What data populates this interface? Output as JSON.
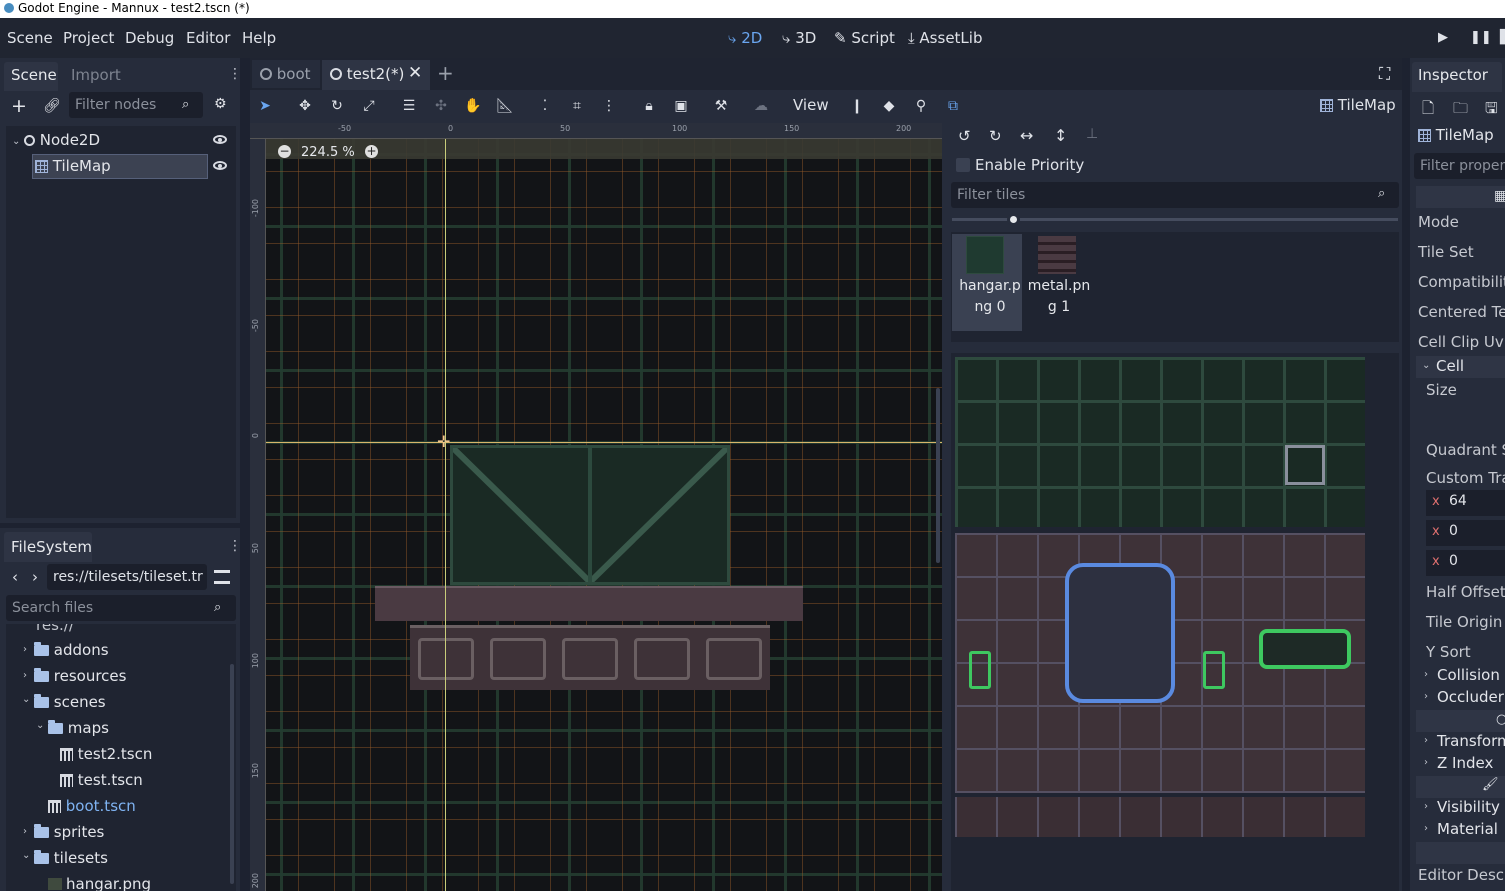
{
  "window": {
    "title": "Godot Engine - Mannux - test2.tscn (*)"
  },
  "menu": [
    "Scene",
    "Project",
    "Debug",
    "Editor",
    "Help"
  ],
  "workspaces": [
    {
      "label": "2D",
      "icon": "2d-icon",
      "active": true
    },
    {
      "label": "3D",
      "icon": "3d-icon",
      "active": false
    },
    {
      "label": "Script",
      "icon": "script-icon",
      "active": false
    },
    {
      "label": "AssetLib",
      "icon": "assetlib-icon",
      "active": false
    }
  ],
  "scene_dock": {
    "tabs": [
      "Scene",
      "Import"
    ],
    "filter_placeholder": "Filter nodes",
    "nodes": [
      {
        "label": "Node2D",
        "icon": "node2d-icon"
      },
      {
        "label": "TileMap",
        "icon": "tilemap-icon",
        "selected": true
      }
    ]
  },
  "filesystem": {
    "title": "FileSystem",
    "path": "res://tilesets/tileset.tr",
    "search_placeholder": "Search files",
    "root": "res://",
    "items": [
      {
        "label": "addons",
        "type": "folder",
        "depth": 1
      },
      {
        "label": "resources",
        "type": "folder",
        "depth": 1
      },
      {
        "label": "scenes",
        "type": "folder",
        "depth": 1,
        "open": true
      },
      {
        "label": "maps",
        "type": "folder",
        "depth": 2,
        "open": true
      },
      {
        "label": "test2.tscn",
        "type": "file",
        "depth": 3
      },
      {
        "label": "test.tscn",
        "type": "file",
        "depth": 3
      },
      {
        "label": "boot.tscn",
        "type": "file",
        "depth": 2,
        "highlight": true
      },
      {
        "label": "sprites",
        "type": "folder",
        "depth": 1
      },
      {
        "label": "tilesets",
        "type": "folder",
        "depth": 1,
        "open": true
      },
      {
        "label": "hangar.png",
        "type": "image",
        "depth": 2
      }
    ]
  },
  "editor_tabs": [
    {
      "label": "boot",
      "active": false
    },
    {
      "label": "test2(*)",
      "active": true
    }
  ],
  "toolbar": {
    "view_label": "View",
    "node_label": "TileMap"
  },
  "viewport": {
    "zoom": "224.5 %",
    "ruler_h": [
      "-50",
      "0",
      "50",
      "100",
      "150",
      "200"
    ],
    "ruler_v": [
      "-100",
      "-50",
      "0",
      "50",
      "100",
      "150",
      "200"
    ]
  },
  "tile_palette": {
    "enable_priority": "Enable Priority",
    "filter_placeholder": "Filter tiles",
    "tilesets": [
      {
        "label": "hangar.png 0",
        "selected": true
      },
      {
        "label": "metal.png 1",
        "selected": false
      }
    ]
  },
  "inspector": {
    "title": "Inspector",
    "node": "TileMap",
    "filter_placeholder": "Filter proper",
    "props": [
      {
        "label": "Mode",
        "indent": 0
      },
      {
        "label": "Tile Set",
        "indent": 0
      },
      {
        "label": "Compatibility",
        "indent": 0
      },
      {
        "label": "Centered Tex",
        "indent": 0
      },
      {
        "label": "Cell Clip Uv",
        "indent": 0
      }
    ],
    "cell_section": "Cell",
    "cell_props": [
      "Size",
      "Quadrant Si",
      "Custom Tran"
    ],
    "transform_values": [
      {
        "axis": "x",
        "value": "64"
      },
      {
        "axis": "x",
        "value": "0"
      },
      {
        "axis": "x",
        "value": "0"
      }
    ],
    "more_props": [
      "Half Offset",
      "Tile Origin",
      "Y Sort"
    ],
    "sections": [
      "Collision",
      "Occluder",
      "Transform",
      "Z Index",
      "Visibility",
      "Material"
    ],
    "footer": "Editor Descri"
  },
  "colors": {
    "accent": "#6aa6f0",
    "bg": "#1d2230",
    "panel": "#262c3b"
  }
}
